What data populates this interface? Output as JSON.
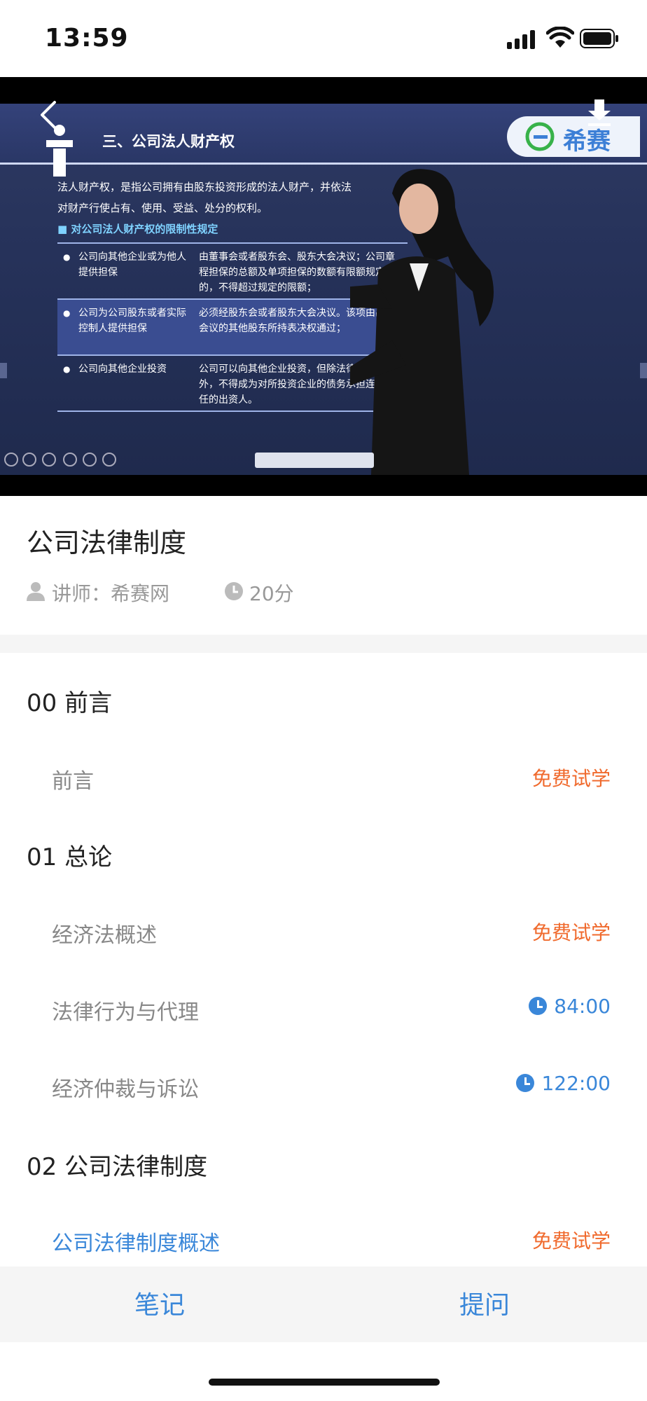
{
  "status_bar": {
    "time": "13:59"
  },
  "video": {
    "slide_title": "三、公司法人财产权",
    "logo_text": "希赛",
    "body_lines": [
      "法人财产权，是指公司拥有由股东投资形成的法人财产，并依法",
      "对财产行使占有、使用、受益、处分的权利。"
    ],
    "subheading": "■ 对公司法人财产权的限制性规定",
    "table": [
      {
        "left": "公司向其他企业或为他人提供担保",
        "right": "由董事会或者股东会、股东大会决议；公司章程担保的总额及单项担保的数额有限额规定的，不得超过规定的限额；"
      },
      {
        "left": "公司为公司股东或者实际控制人提供担保",
        "right": "必须经股东会或者股东大会决议。该项由出席会议的其他股东所持表决权通过；"
      },
      {
        "left": "公司向其他企业投资",
        "right": "公司可以向其他企业投资，但除法律另有规定外，不得成为对所投资企业的债务承担连带责任的出资人。"
      }
    ]
  },
  "course": {
    "title": "公司法律制度",
    "lecturer": "讲师：希赛网",
    "duration": "20分"
  },
  "chapters": [
    {
      "title": "00 前言",
      "lessons": [
        {
          "name": "前言",
          "badge": "免费试学",
          "type": "free"
        }
      ]
    },
    {
      "title": "01 总论",
      "lessons": [
        {
          "name": "经济法概述",
          "badge": "免费试学",
          "type": "free"
        },
        {
          "name": "法律行为与代理",
          "badge": "84:00",
          "type": "time"
        },
        {
          "name": "经济仲裁与诉讼",
          "badge": "122:00",
          "type": "time"
        }
      ]
    },
    {
      "title": "02 公司法律制度",
      "lessons": [
        {
          "name": "公司法律制度概述",
          "badge": "免费试学",
          "type": "free",
          "active": true
        }
      ]
    }
  ],
  "bottom_bar": {
    "notes": "笔记",
    "ask": "提问"
  },
  "colors": {
    "accent_blue": "#3a87d9",
    "free_orange": "#f06a2d"
  }
}
